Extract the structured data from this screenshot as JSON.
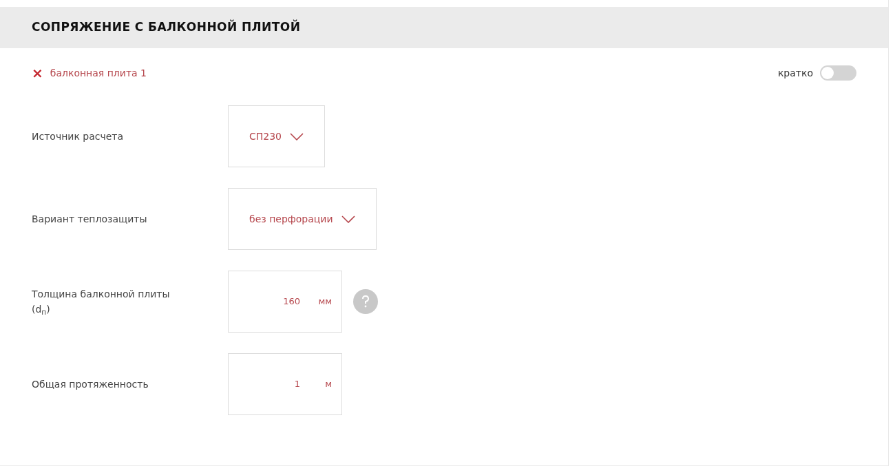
{
  "section": {
    "title": "СОПРЯЖЕНИЕ С БАЛКОННОЙ ПЛИТОЙ"
  },
  "item": {
    "remove_icon": "×",
    "label": "балконная плита 1"
  },
  "brief_toggle": {
    "label": "кратко",
    "on": false
  },
  "fields": [
    {
      "kind": "select",
      "label": "Источник расчета",
      "value": "СП230"
    },
    {
      "kind": "select",
      "label": "Вариант теплозащиты",
      "value": "без перфорации"
    },
    {
      "kind": "number",
      "label": "Толщина балконной плиты (d$_{п}$)",
      "value": "160",
      "unit": "мм",
      "help": true
    },
    {
      "kind": "number",
      "label": "Общая протяженность",
      "value": "1",
      "unit": "м",
      "help": false
    }
  ]
}
